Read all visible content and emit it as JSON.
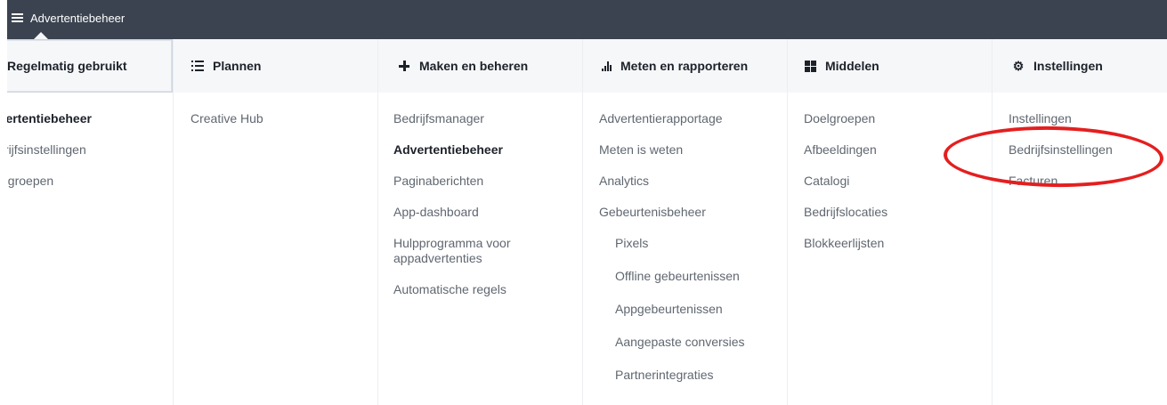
{
  "topbar": {
    "title": "Advertentiebeheer"
  },
  "columns": {
    "recent": {
      "title": "Regelmatig gebruikt",
      "items": [
        "Advertentiebeheer",
        "Bedrijfsinstellingen",
        "Doelgroepen"
      ]
    },
    "plan": {
      "title": "Plannen",
      "items": [
        "Creative Hub"
      ]
    },
    "create": {
      "title": "Maken en beheren",
      "items": [
        "Bedrijfsmanager",
        "Advertentiebeheer",
        "Paginaberichten",
        "App-dashboard",
        "Hulpprogramma voor appadvertenties",
        "Automatische regels"
      ]
    },
    "measure": {
      "title": "Meten en rapporteren",
      "items": [
        "Advertentierapportage",
        "Meten is weten",
        "Analytics",
        "Gebeurtenisbeheer"
      ],
      "subitems": [
        "Pixels",
        "Offline gebeurtenissen",
        "Appgebeurtenissen",
        "Aangepaste conversies",
        "Partnerintegraties"
      ]
    },
    "assets": {
      "title": "Middelen",
      "items": [
        "Doelgroepen",
        "Afbeeldingen",
        "Catalogi",
        "Bedrijfslocaties",
        "Blokkeerlijsten"
      ]
    },
    "settings": {
      "title": "Instellingen",
      "items": [
        "Instellingen",
        "Bedrijfsinstellingen",
        "Facturen"
      ]
    }
  },
  "icons": {
    "topbar": "hamburger-icon",
    "plan": "list-icon",
    "create": "plus-icon",
    "measure": "bar-chart-icon",
    "assets": "grid-icon",
    "settings": "gear-icon"
  },
  "colors": {
    "topbar_bg": "#3b4350",
    "header_bg": "#f6f7f9",
    "text_muted": "#606770",
    "text_active": "#1d2129",
    "highlight_oval": "#e41f1f"
  },
  "annotation": {
    "highlighted_item": "Bedrijfsinstellingen"
  }
}
